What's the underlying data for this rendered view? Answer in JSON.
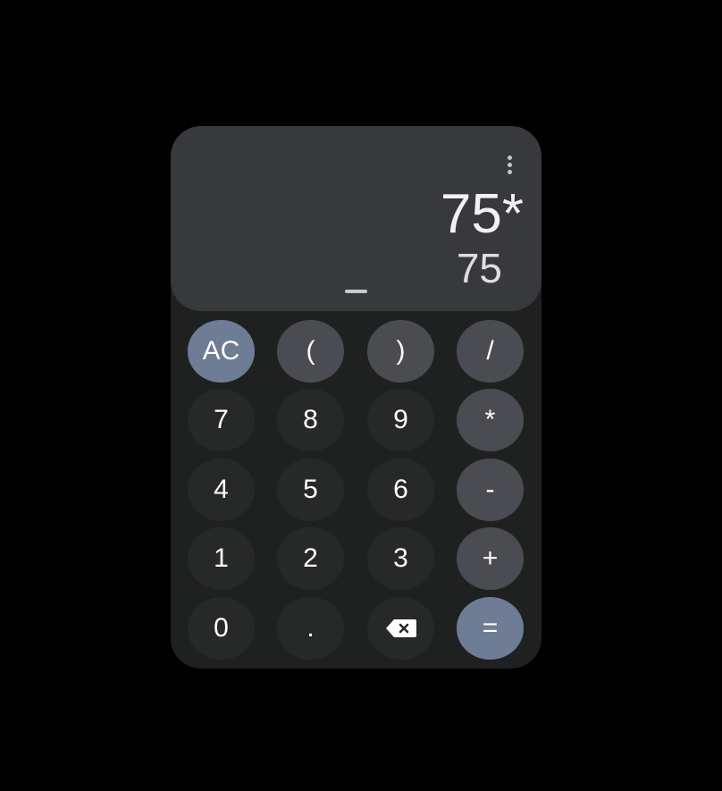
{
  "display": {
    "expression": "75*",
    "result": "75"
  },
  "menu": {
    "icon": "more-vertical-icon"
  },
  "colors": {
    "page_background": "#000000",
    "calculator_background": "#1f2020",
    "display_background": "#38393c",
    "number_key": "#272929",
    "operator_key": "#4b4c51",
    "accent_key": "#6f7c96",
    "text": "#ffffff"
  },
  "keys": {
    "clear": "AC",
    "open_paren": "(",
    "close_paren": ")",
    "divide": "/",
    "seven": "7",
    "eight": "8",
    "nine": "9",
    "multiply": "*",
    "four": "4",
    "five": "5",
    "six": "6",
    "subtract": "-",
    "one": "1",
    "two": "2",
    "three": "3",
    "add": "+",
    "zero": "0",
    "decimal": ".",
    "backspace_icon": "backspace-icon",
    "equals": "="
  }
}
